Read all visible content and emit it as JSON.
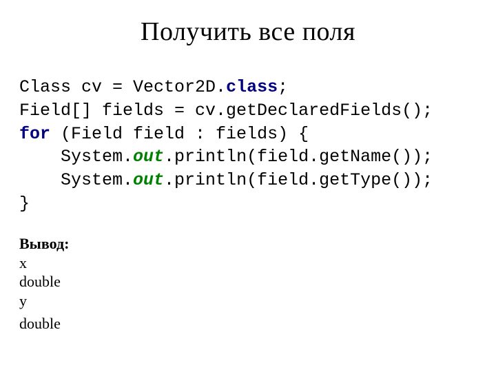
{
  "title": "Получить все поля",
  "code": {
    "l1a": "Class cv = Vector2D.",
    "l1b": "class",
    "l1c": ";",
    "l2": "Field[] fields = cv.getDeclaredFields();",
    "l3a": "for",
    "l3b": " (Field field : fields) {",
    "l4a": "    System.",
    "l4b": "out",
    "l4c": ".println(field.getName());",
    "l5a": "    System.",
    "l5b": "out",
    "l5c": ".println(field.getType());",
    "l6": "}"
  },
  "output": {
    "label": "Вывод:",
    "lines": [
      "x",
      "double",
      "y",
      "double"
    ]
  }
}
